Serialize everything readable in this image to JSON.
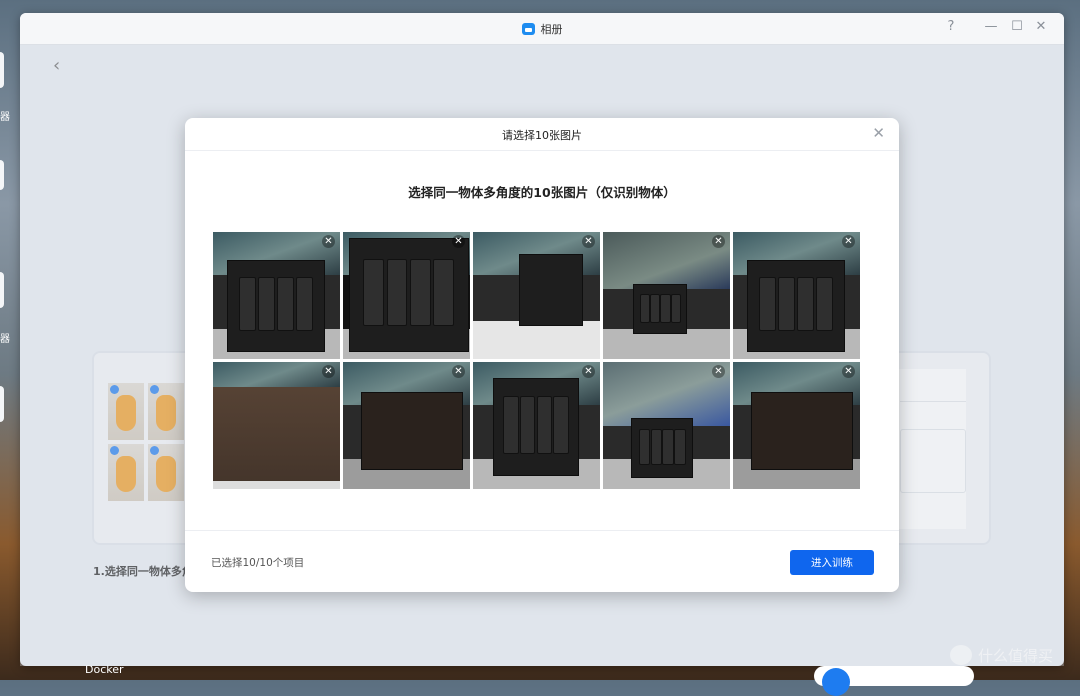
{
  "window": {
    "title": "相册",
    "help": "?",
    "minimize": "—",
    "maximize": "☐",
    "close": "✕"
  },
  "page": {
    "back": "‹"
  },
  "background": {
    "task_label": "1.选择同一物体多角",
    "dock_label": "Docker",
    "side_labels": [
      "器",
      "器"
    ]
  },
  "modal": {
    "title": "请选择10张图片",
    "close": "✕",
    "subtitle": "选择同一物体多角度的10张图片（仅识别物体）",
    "photos": [
      {
        "variant": "front",
        "remove": "✕"
      },
      {
        "variant": "angle",
        "remove": "✕"
      },
      {
        "variant": "open",
        "remove": "✕"
      },
      {
        "variant": "small",
        "remove": "✕"
      },
      {
        "variant": "front",
        "remove": "✕"
      },
      {
        "variant": "texture",
        "remove": "✕"
      },
      {
        "variant": "side",
        "remove": "✕"
      },
      {
        "variant": "three",
        "remove": "✕"
      },
      {
        "variant": "green",
        "remove": "✕"
      },
      {
        "variant": "side",
        "remove": "✕"
      }
    ],
    "status": "已选择10/10个项目",
    "confirm_button": "进入训练"
  },
  "watermark": "什么值得买",
  "colors": {
    "primary": "#0f66ee",
    "app_icon": "#1e8cf0"
  }
}
